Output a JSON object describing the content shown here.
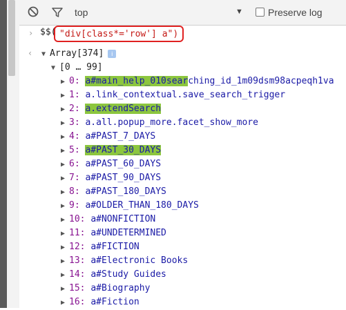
{
  "toolbar": {
    "context": "top",
    "dropdown_arrow": "▼",
    "preserve_log_label": "Preserve log",
    "icons": {
      "clear": "clear-console-icon",
      "filter": "filter-icon"
    }
  },
  "command": {
    "prompt": "›",
    "dollar": "$$(",
    "argument": "\"div[class*='row'] a\")"
  },
  "result": {
    "arrow": "‹",
    "array_label": "Array[374]",
    "info_badge": "i",
    "group_label": "[0 … 99]",
    "items": [
      {
        "index": "0",
        "value": "a#main_help_010searching_id_1m09dsm98acpeqh1va",
        "highlight": "a#main_help_010sear"
      },
      {
        "index": "1",
        "value": "a.link_contextual.save_search_trigger"
      },
      {
        "index": "2",
        "value": "a.extendSearch",
        "highlight": "a.extendSearch"
      },
      {
        "index": "3",
        "value": "a.all.popup_more.facet_show_more"
      },
      {
        "index": "4",
        "value": "a#PAST_7_DAYS"
      },
      {
        "index": "5",
        "value": "a#PAST_30_DAYS",
        "highlight": "a#PAST_30_DAYS"
      },
      {
        "index": "6",
        "value": "a#PAST_60_DAYS"
      },
      {
        "index": "7",
        "value": "a#PAST_90_DAYS"
      },
      {
        "index": "8",
        "value": "a#PAST_180_DAYS"
      },
      {
        "index": "9",
        "value": "a#OLDER_THAN_180_DAYS"
      },
      {
        "index": "10",
        "value": "a#NONFICTION"
      },
      {
        "index": "11",
        "value": "a#UNDETERMINED"
      },
      {
        "index": "12",
        "value": "a#FICTION"
      },
      {
        "index": "13",
        "value": "a#Electronic Books"
      },
      {
        "index": "14",
        "value": "a#Study Guides"
      },
      {
        "index": "15",
        "value": "a#Biography"
      },
      {
        "index": "16",
        "value": "a#Fiction"
      }
    ]
  },
  "colors": {
    "highlight": "#8cc63e",
    "command_box_border": "#e02020",
    "index_color": "#881391",
    "selector_color": "#1a1aa6"
  }
}
